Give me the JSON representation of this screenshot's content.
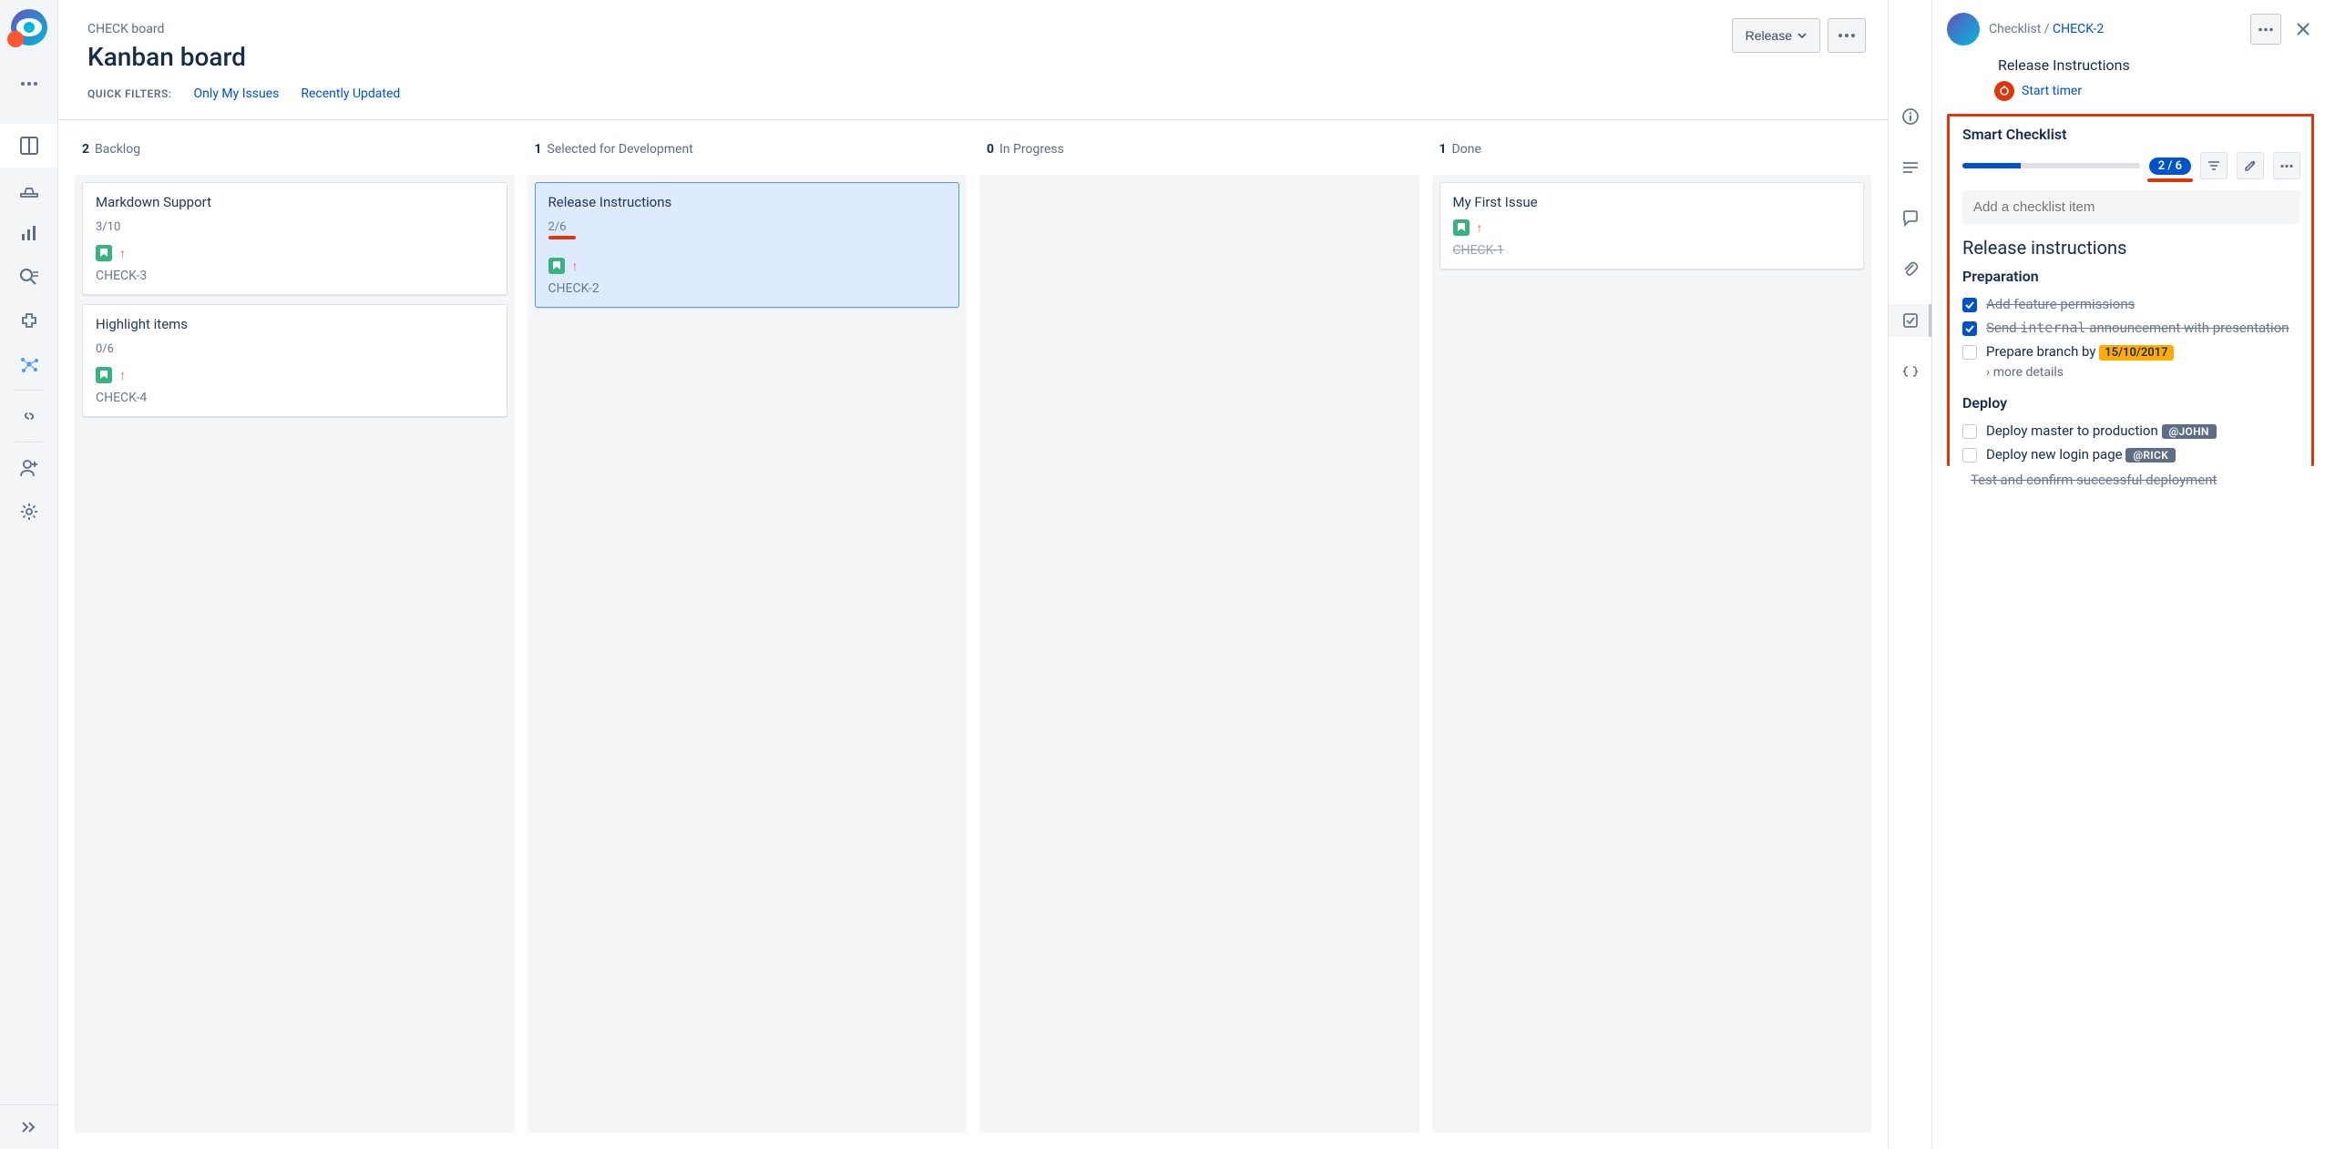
{
  "breadcrumb": "CHECK board",
  "title": "Kanban board",
  "release_label": "Release",
  "filters": {
    "label": "QUICK FILTERS:",
    "f1": "Only My Issues",
    "f2": "Recently Updated"
  },
  "columns": {
    "backlog": {
      "count": "2",
      "name": "Backlog"
    },
    "selected": {
      "count": "1",
      "name": "Selected for Development"
    },
    "inprogress": {
      "count": "0",
      "name": "In Progress"
    },
    "done": {
      "count": "1",
      "name": "Done"
    }
  },
  "cards": {
    "c1": {
      "title": "Markdown Support",
      "progress": "3/10",
      "key": "CHECK-3"
    },
    "c2": {
      "title": "Highlight items",
      "progress": "0/6",
      "key": "CHECK-4"
    },
    "c3": {
      "title": "Release Instructions",
      "progress": "2/6",
      "key": "CHECK-2"
    },
    "c4": {
      "title": "My First Issue",
      "key": "CHECK-1"
    }
  },
  "panel": {
    "crumb_label": "Checklist",
    "crumb_sep": " / ",
    "crumb_key": "CHECK-2",
    "issue_title": "Release Instructions",
    "start_timer": "Start timer",
    "smart_title": "Smart Checklist",
    "count_badge": "2 / 6",
    "add_placeholder": "Add a checklist item",
    "heading": "Release instructions",
    "section1": "Preparation",
    "item1": "Add feature permissions",
    "item2a": "Send ",
    "item2b": "internal",
    "item2c": " announcement with presentation",
    "item3": "Prepare branch by ",
    "item3_date": "15/10/2017",
    "more_details": "more details",
    "section2": "Deploy",
    "item4": "Deploy master to production ",
    "item4_user": "@JOHN",
    "item5": "Deploy new login page ",
    "item5_user": "@RICK",
    "truncated": "Test and confirm successful deployment"
  }
}
